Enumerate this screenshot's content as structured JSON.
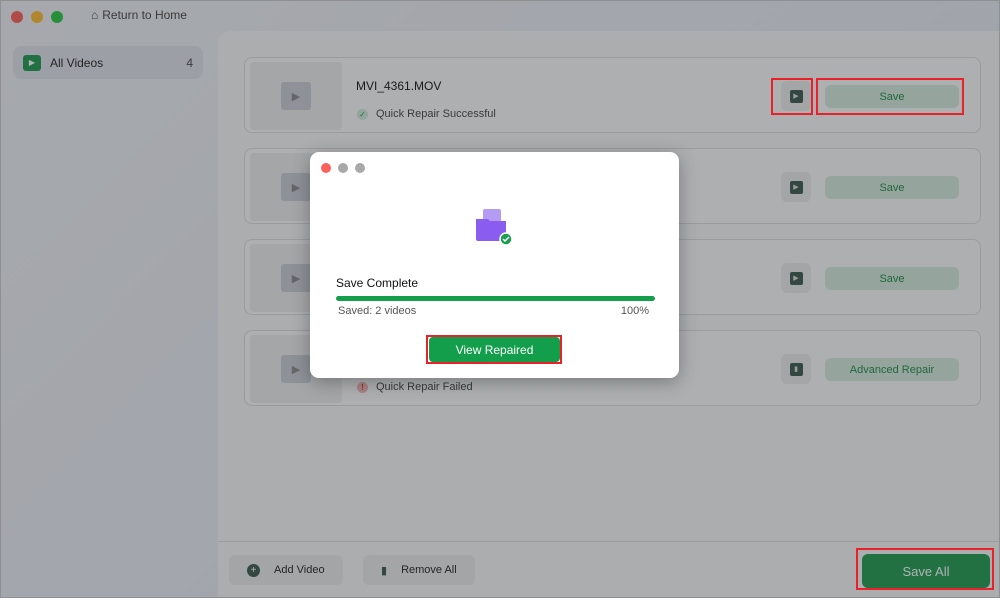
{
  "titlebar": {
    "home_label": "Return to Home"
  },
  "sidebar": {
    "items": [
      {
        "label": "All Videos",
        "count": "4"
      }
    ]
  },
  "videos": [
    {
      "name": "MVI_4361.MOV",
      "status": "Quick Repair Successful",
      "action": "Save",
      "icon": "play-icon"
    },
    {
      "name": "",
      "status": "",
      "action": "Save",
      "icon": "play-icon"
    },
    {
      "name": "",
      "status": "",
      "action": "Save",
      "icon": "play-icon"
    },
    {
      "name": "",
      "status": "Quick Repair Failed",
      "action": "Advanced Repair",
      "icon": "trash-icon"
    }
  ],
  "footer": {
    "add_video": "Add Video",
    "remove_all": "Remove All",
    "save_all": "Save All"
  },
  "modal": {
    "title": "Save Complete",
    "saved_text": "Saved: 2 videos",
    "percent": "100%",
    "progress": 1.0,
    "button": "View Repaired"
  },
  "colors": {
    "accent": "#129e4b",
    "highlight": "#e8212b"
  }
}
